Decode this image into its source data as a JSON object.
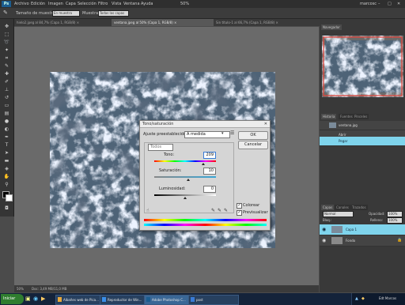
{
  "menu": {
    "items": [
      "Archivo",
      "Edición",
      "Imagen",
      "Capa",
      "Selección",
      "Filtro",
      "Vista",
      "Ventana",
      "Ayuda"
    ],
    "zoom": "50%",
    "user": "marcosc"
  },
  "options": {
    "size_label": "Tamaño de muestra:",
    "size_value": "En muestra",
    "sample_label": "Muestra:",
    "sample_value": "Todas las capas"
  },
  "tabs": [
    {
      "label": "hielo2.jpeg al 84,7% (Capa 1, RGB/8) ×",
      "active": false
    },
    {
      "label": "ventana.jpeg al 50% (Capa 1, RGB/8) ×",
      "active": true
    },
    {
      "label": "Sin título-1 al 66,7% (Capa 1, RGB/8) ×",
      "active": false
    }
  ],
  "status": {
    "zoom": "50%",
    "doc": "Doc: 3,49 MB/11,0 MB"
  },
  "navigator": {
    "tab": "Navegador"
  },
  "history": {
    "tabs": [
      "Historia",
      "Fuentes",
      "Pinceles"
    ],
    "snapshot": "ventana.jpg",
    "items": [
      {
        "label": "Abrir",
        "selected": false
      },
      {
        "label": "Pegar",
        "selected": true
      }
    ]
  },
  "layers": {
    "tabs": [
      "Capas",
      "Canales",
      "Trazados"
    ],
    "blend": "Normal",
    "opacity_label": "Opacidad:",
    "opacity": "100%",
    "lock_label": "Bloq.:",
    "fill_label": "Relleno:",
    "fill": "100%",
    "items": [
      {
        "label": "Capa 1",
        "selected": true
      },
      {
        "label": "Fondo",
        "selected": false
      }
    ]
  },
  "dialog": {
    "title": "Tono/saturación",
    "preset_label": "Ajuste preestablecido:",
    "preset_value": "A medida",
    "channel": "Todos",
    "hue_label": "Tono:",
    "hue_value": "209",
    "sat_label": "Saturación:",
    "sat_value": "10",
    "light_label": "Luminosidad:",
    "light_value": "0",
    "colorize_label": "Colorear",
    "preview_label": "Previsualizar",
    "ok": "OK",
    "cancel": "Cancelar",
    "hue_level": 0.79,
    "sat_level": 0.55,
    "light_level": 0.5
  },
  "taskbar": {
    "start": "Iniciar",
    "buttons": [
      {
        "label": "Albañes web de Pica...",
        "active": false
      },
      {
        "label": "Reproductor de Win...",
        "active": false
      },
      {
        "label": "Adobe Photoshop C...",
        "active": true
      },
      {
        "label": "post",
        "active": false
      }
    ],
    "clock": "Edt Marcos"
  },
  "colors": {
    "accent": "#7fd4ec",
    "image_tint": "#5b6f82",
    "taskbar": "#14233a"
  }
}
